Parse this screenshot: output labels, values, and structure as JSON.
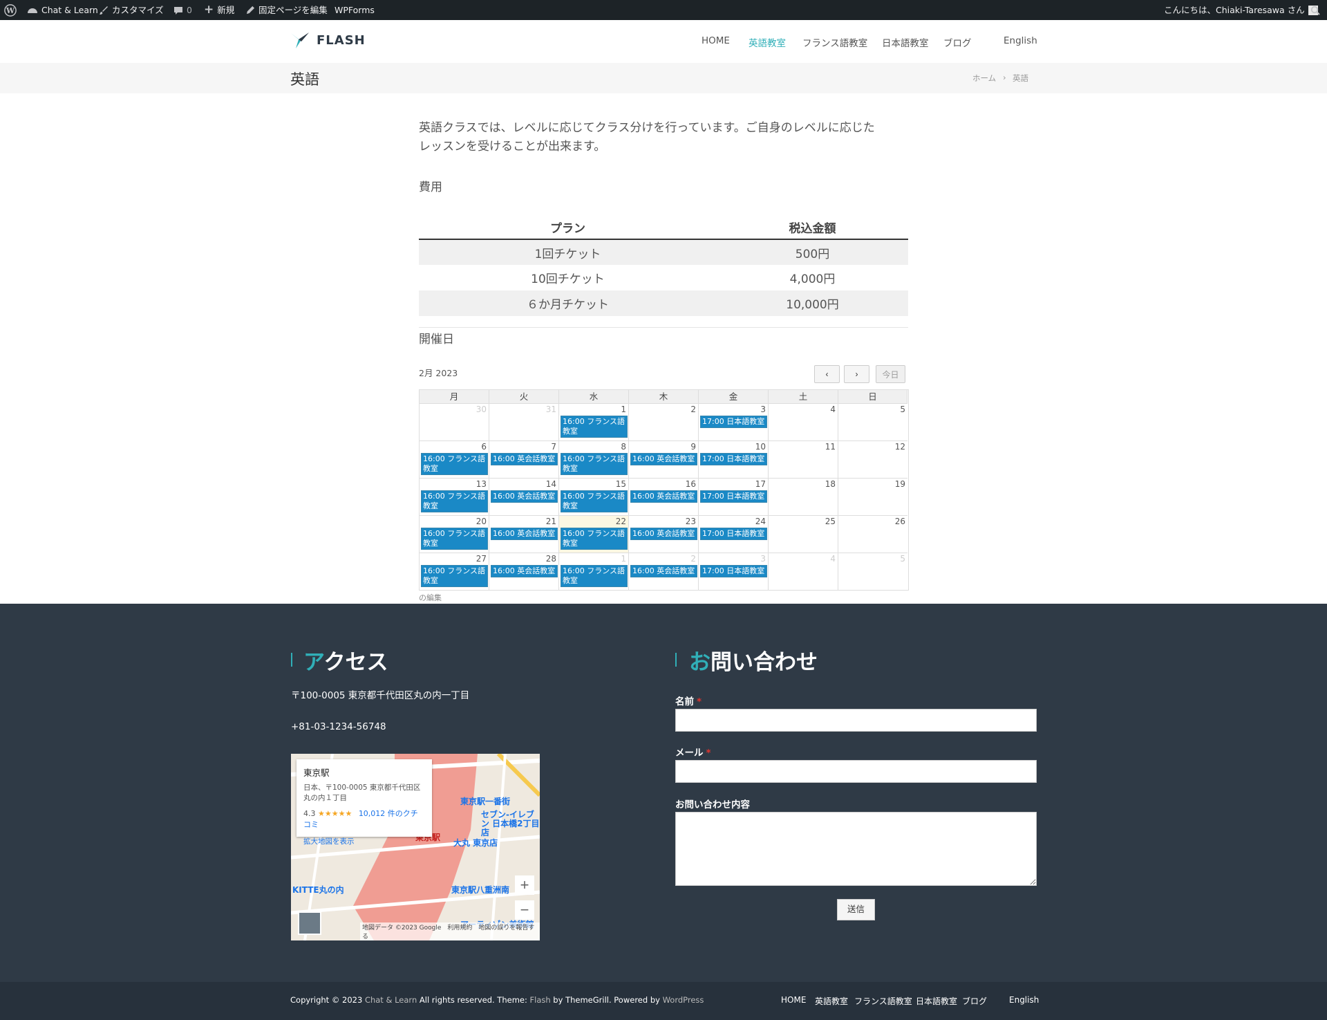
{
  "admin_bar": {
    "site_name": "Chat & Learn",
    "customize": "カスタマイズ",
    "comments_count": "0",
    "new": "新規",
    "edit_page": "固定ページを編集",
    "wpforms": "WPForms",
    "greeting": "こんにちは、Chiaki-Taresawa さん"
  },
  "header": {
    "logo_text": "FLASH",
    "nav": [
      "HOME",
      "英語教室",
      "フランス語教室",
      "日本語教室",
      "ブログ"
    ],
    "active_nav": "英語教室",
    "language": "English"
  },
  "title_bar": {
    "title": "英語",
    "breadcrumb": [
      "ホーム",
      "英語"
    ]
  },
  "content": {
    "intro_line1": "英語クラスでは、レベルに応じてクラス分けを行っています。ご自身のレベルに応じた",
    "intro_line2": "レッスンを受けることが出来ます。",
    "fee_heading": "費用",
    "table": {
      "headers": [
        "プラン",
        "税込金額"
      ],
      "rows": [
        [
          "1回チケット",
          "500円"
        ],
        [
          "10回チケット",
          "4,000円"
        ],
        [
          "６か月チケット",
          "10,000円"
        ]
      ]
    },
    "days_heading": "開催日"
  },
  "calendar": {
    "month_label": "2月 2023",
    "prev_label": "‹",
    "next_label": "›",
    "today_label": "今日",
    "weekdays": [
      "月",
      "火",
      "水",
      "木",
      "金",
      "土",
      "日"
    ],
    "weeks": [
      [
        {
          "d": "30",
          "other": true
        },
        {
          "d": "31",
          "other": true
        },
        {
          "d": "1",
          "ev": "16:00 フランス語教室"
        },
        {
          "d": "2"
        },
        {
          "d": "3",
          "ev": "17:00 日本語教室"
        },
        {
          "d": "4"
        },
        {
          "d": "5"
        }
      ],
      [
        {
          "d": "6",
          "ev": "16:00 フランス語教室"
        },
        {
          "d": "7",
          "ev": "16:00 英会話教室"
        },
        {
          "d": "8",
          "ev": "16:00 フランス語教室"
        },
        {
          "d": "9",
          "ev": "16:00 英会話教室"
        },
        {
          "d": "10",
          "ev": "17:00 日本語教室"
        },
        {
          "d": "11"
        },
        {
          "d": "12"
        }
      ],
      [
        {
          "d": "13",
          "ev": "16:00 フランス語教室"
        },
        {
          "d": "14",
          "ev": "16:00 英会話教室"
        },
        {
          "d": "15",
          "ev": "16:00 フランス語教室"
        },
        {
          "d": "16",
          "ev": "16:00 英会話教室"
        },
        {
          "d": "17",
          "ev": "17:00 日本語教室"
        },
        {
          "d": "18"
        },
        {
          "d": "19"
        }
      ],
      [
        {
          "d": "20",
          "ev": "16:00 フランス語教室"
        },
        {
          "d": "21",
          "ev": "16:00 英会話教室"
        },
        {
          "d": "22",
          "ev": "16:00 フランス語教室",
          "today": true
        },
        {
          "d": "23",
          "ev": "16:00 英会話教室"
        },
        {
          "d": "24",
          "ev": "17:00 日本語教室"
        },
        {
          "d": "25"
        },
        {
          "d": "26"
        }
      ],
      [
        {
          "d": "27",
          "ev": "16:00 フランス語教室"
        },
        {
          "d": "28",
          "ev": "16:00 英会話教室"
        },
        {
          "d": "1",
          "other": true,
          "ev": "16:00 フランス語教室"
        },
        {
          "d": "2",
          "other": true,
          "ev": "16:00 英会話教室"
        },
        {
          "d": "3",
          "other": true,
          "ev": "17:00 日本語教室"
        },
        {
          "d": "4",
          "other": true
        },
        {
          "d": "5",
          "other": true
        }
      ]
    ],
    "edit_link": "の編集"
  },
  "footer": {
    "access_title_accent": "ア",
    "access_title_rest": "クセス",
    "address": "〒100-0005 東京都千代田区丸の内一丁目",
    "phone": "+81-03-1234-56748",
    "map": {
      "place": "東京駅",
      "place_address": "日本、〒100-0005 東京都千代田区丸の内１丁目",
      "rating": "4.3",
      "stars": "★★★★★",
      "reviews": "10,012 件のクチコミ",
      "enlarge": "拡大地図を表示",
      "zoom_in": "+",
      "zoom_out": "−",
      "attribution": "地図データ ©2023 Google　利用規約　地図の誤りを報告する",
      "labels": [
        "東京駅一番街",
        "セブン-イレブン 日本橋2丁目店",
        "大丸 東京店",
        "KITTE丸の内",
        "東京駅八重洲南",
        "アーティゾン美術館",
        "東京駅"
      ]
    },
    "contact_title_accent": "お",
    "contact_title_rest": "問い合わせ",
    "name_label": "名前",
    "email_label": "メール",
    "message_label": "お問い合わせ内容",
    "submit": "送信",
    "required_mark": "*"
  },
  "bottom": {
    "copy_prefix": "Copyright © 2023 ",
    "site_link": "Chat & Learn",
    "copy_mid": " All rights reserved. Theme: ",
    "theme_link": "Flash",
    "copy_mid2": " by ThemeGrill. Powered by ",
    "wp_link": "WordPress",
    "nav": [
      "HOME",
      "英語教室",
      "フランス語教室",
      "日本語教室",
      "ブログ"
    ],
    "language": "English"
  },
  "colors": {
    "accent": "#30afb8",
    "event": "#1a89c6",
    "footer_bg": "#2f3a46",
    "admin_bg": "#1d2327"
  }
}
